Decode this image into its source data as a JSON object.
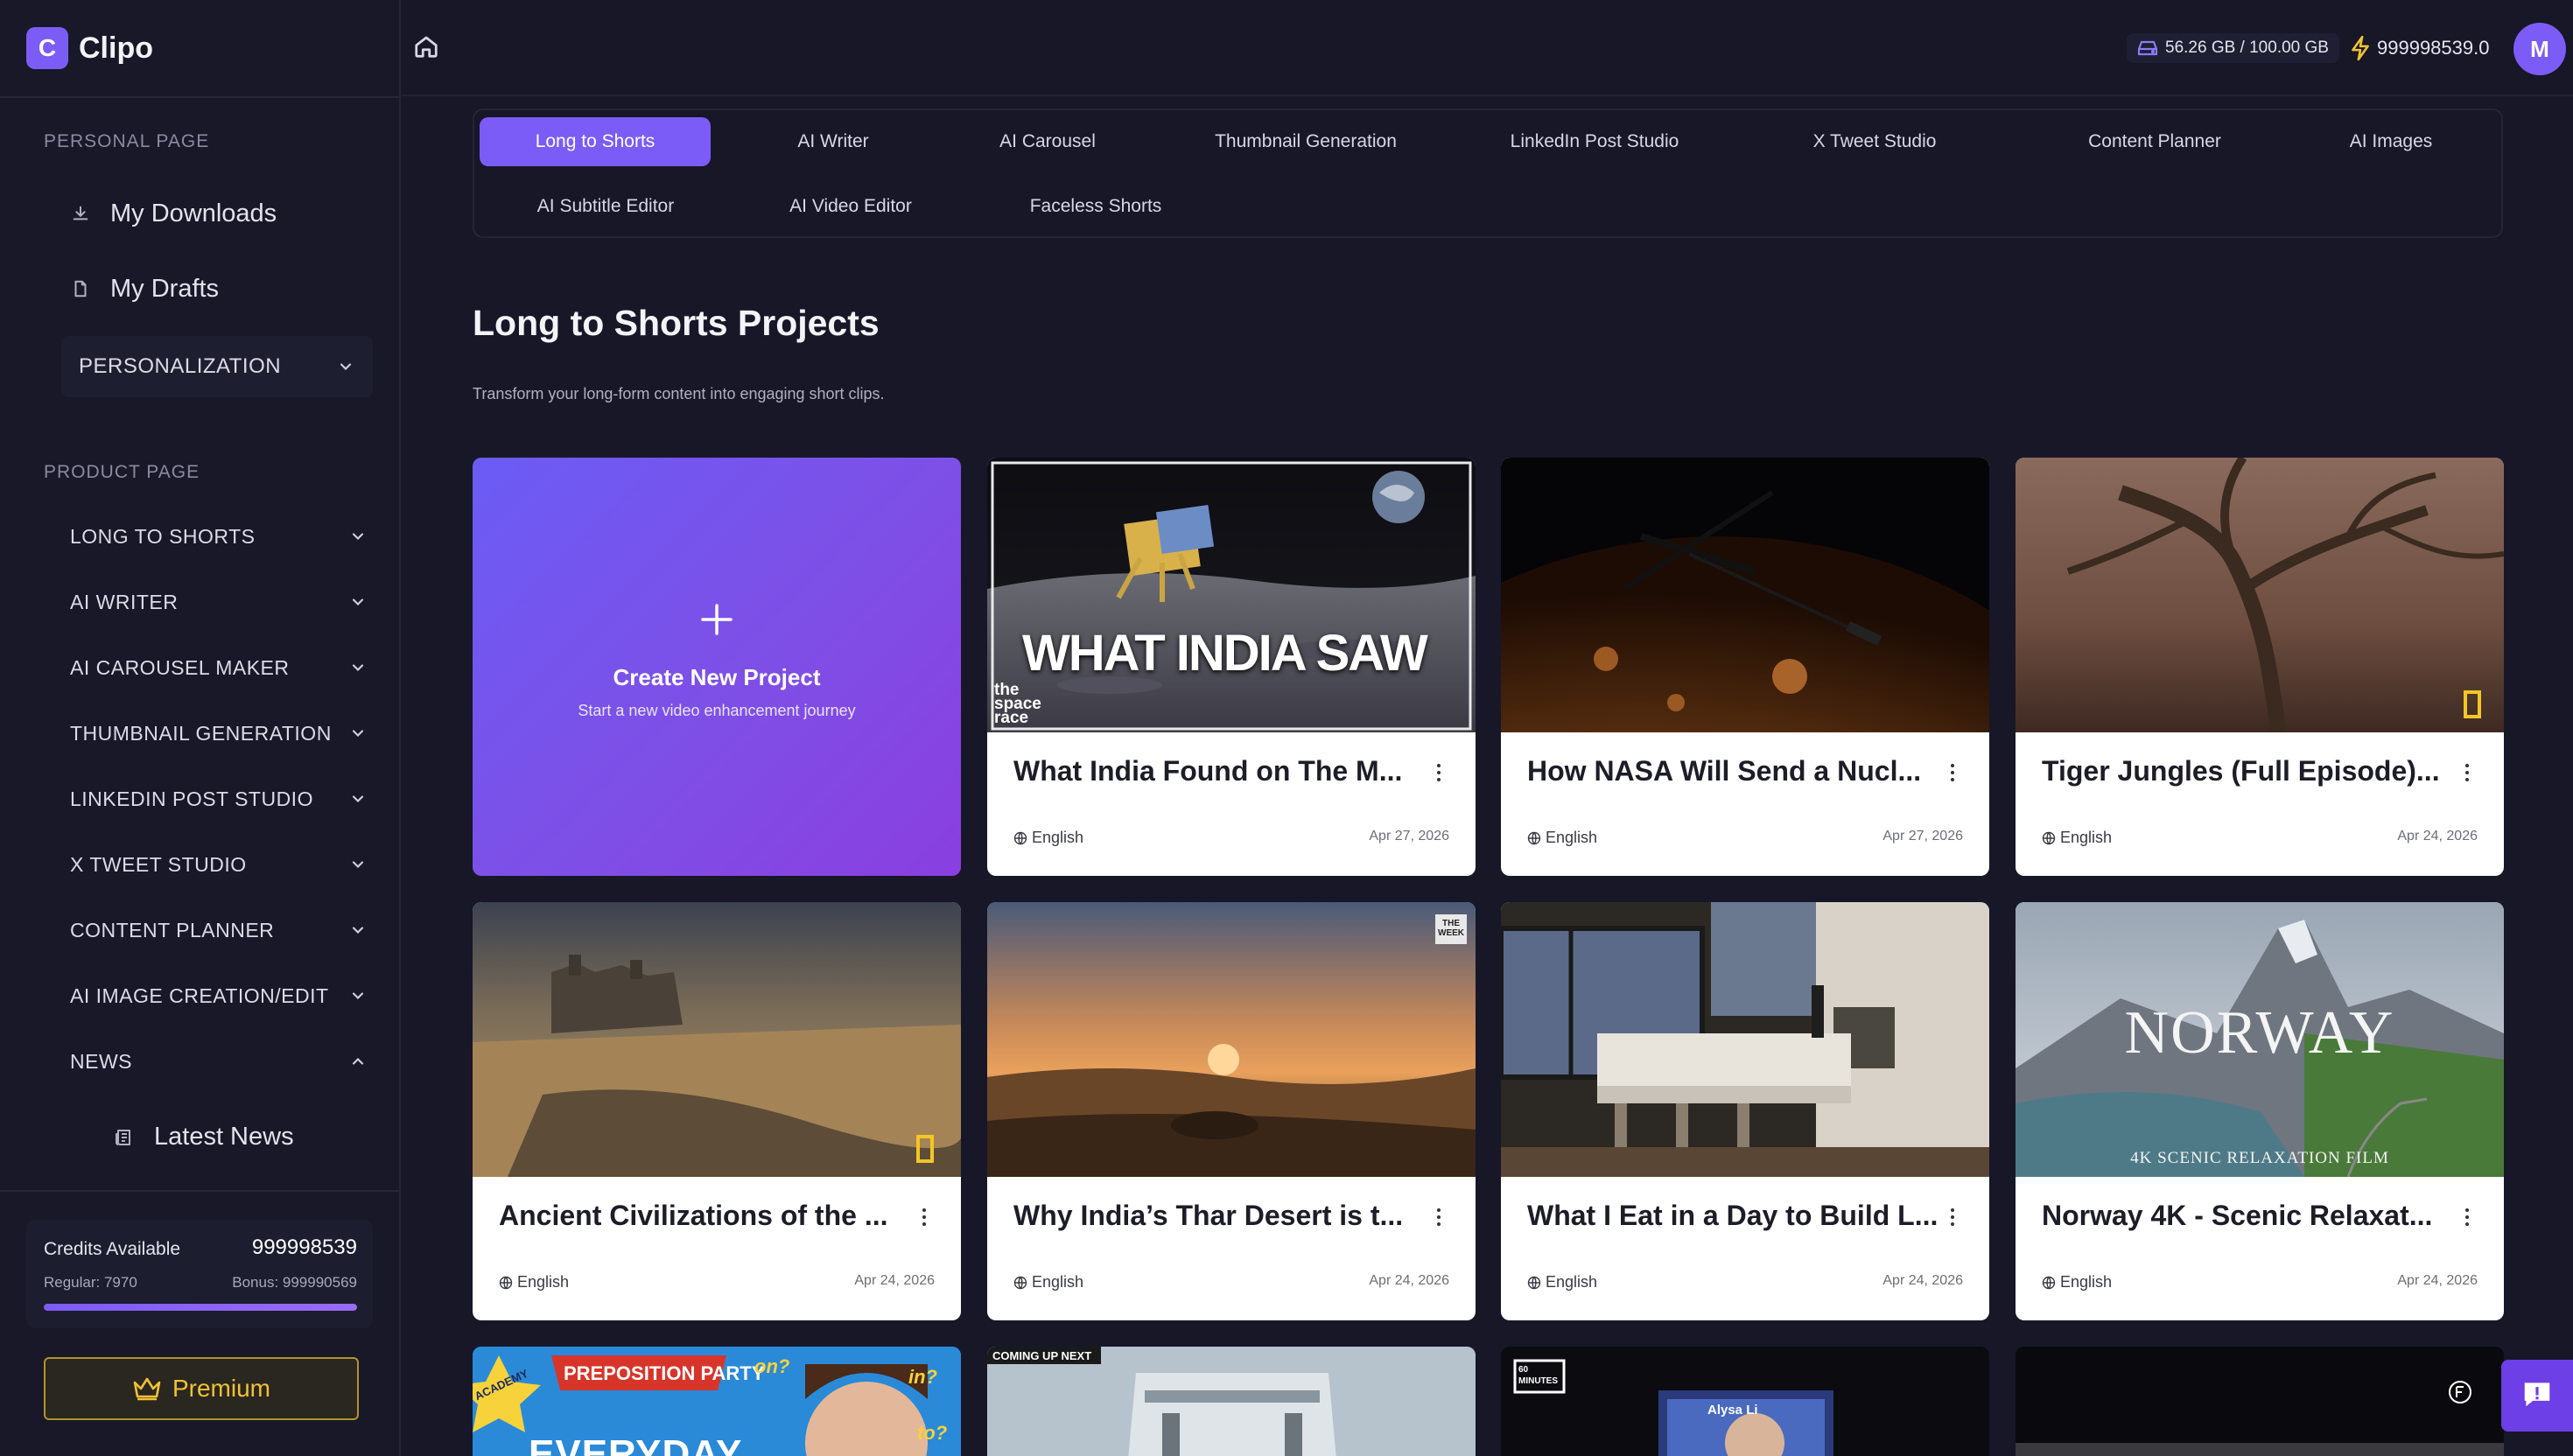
{
  "app": {
    "logo_letter": "C",
    "name": "Clipo"
  },
  "sidebar": {
    "personal_label": "PERSONAL PAGE",
    "downloads": "My Downloads",
    "drafts": "My Drafts",
    "personalization": "PERSONALIZATION",
    "product_label": "PRODUCT PAGE",
    "items": [
      {
        "label": "LONG TO SHORTS",
        "expanded": false
      },
      {
        "label": "AI WRITER",
        "expanded": false
      },
      {
        "label": "AI CAROUSEL MAKER",
        "expanded": false
      },
      {
        "label": "THUMBNAIL GENERATION",
        "expanded": false
      },
      {
        "label": "LINKEDIN POST STUDIO",
        "expanded": false
      },
      {
        "label": "X TWEET STUDIO",
        "expanded": false
      },
      {
        "label": "CONTENT PLANNER",
        "expanded": false
      },
      {
        "label": "AI IMAGE CREATION/EDIT",
        "expanded": false
      },
      {
        "label": "NEWS",
        "expanded": true
      }
    ],
    "latest_news": "Latest News",
    "credits": {
      "label": "Credits Available",
      "value": "999998539",
      "regular": "Regular: 7970",
      "bonus": "Bonus: 999990569",
      "fill_fraction": 1.0
    },
    "premium": "Premium"
  },
  "topbar": {
    "storage": "56.26 GB / 100.00 GB",
    "credits": "999998539.0",
    "avatar_letter": "M"
  },
  "tabs": [
    {
      "label": "Long to Shorts",
      "active": true
    },
    {
      "label": "AI Writer",
      "active": false
    },
    {
      "label": "AI Carousel",
      "active": false
    },
    {
      "label": "Thumbnail Generation",
      "active": false
    },
    {
      "label": "LinkedIn Post Studio",
      "active": false
    },
    {
      "label": "X Tweet Studio",
      "active": false
    },
    {
      "label": "Content Planner",
      "active": false
    },
    {
      "label": "AI Images",
      "active": false
    },
    {
      "label": "AI Subtitle Editor",
      "active": false
    },
    {
      "label": "AI Video Editor",
      "active": false
    },
    {
      "label": "Faceless Shorts",
      "active": false
    }
  ],
  "main": {
    "title": "Long to Shorts Projects",
    "subtitle": "Transform your long-form content into engaging short clips.",
    "create": {
      "title": "Create New Project",
      "subtitle": "Start a new video enhancement journey"
    },
    "projects": [
      {
        "title": "What India Found on The M...",
        "language": "English",
        "date": "Apr 27, 2026",
        "thumb_text": "WHAT INDIA SAW",
        "thumb_caption": "the space race"
      },
      {
        "title": "How NASA Will Send a Nucl...",
        "language": "English",
        "date": "Apr 27, 2026"
      },
      {
        "title": "Tiger Jungles (Full Episode)...",
        "language": "English",
        "date": "Apr 24, 2026"
      },
      {
        "title": "Ancient Civilizations of the ...",
        "language": "English",
        "date": "Apr 24, 2026"
      },
      {
        "title": "Why India’s Thar Desert is t...",
        "language": "English",
        "date": "Apr 24, 2026",
        "thumb_badge": "THE WEEK"
      },
      {
        "title": "What I Eat in a Day to Build L...",
        "language": "English",
        "date": "Apr 24, 2026"
      },
      {
        "title": "Norway 4K - Scenic Relaxat...",
        "language": "English",
        "date": "Apr 24, 2026",
        "thumb_text": "NORWAY",
        "thumb_caption": "4K SCENIC RELAXATION FILM"
      }
    ],
    "partial": {
      "p1_banner": "PREPOSITION PARTY",
      "p1_academy": "ACADEMY",
      "p1_big": "EVERYDAY",
      "p1_on": "on?",
      "p1_in": "in?",
      "p1_to": "to?",
      "p2_label": "COMING UP NEXT",
      "p3_logo": "60 MINUTES",
      "p3_name": "Alysa Li"
    }
  }
}
